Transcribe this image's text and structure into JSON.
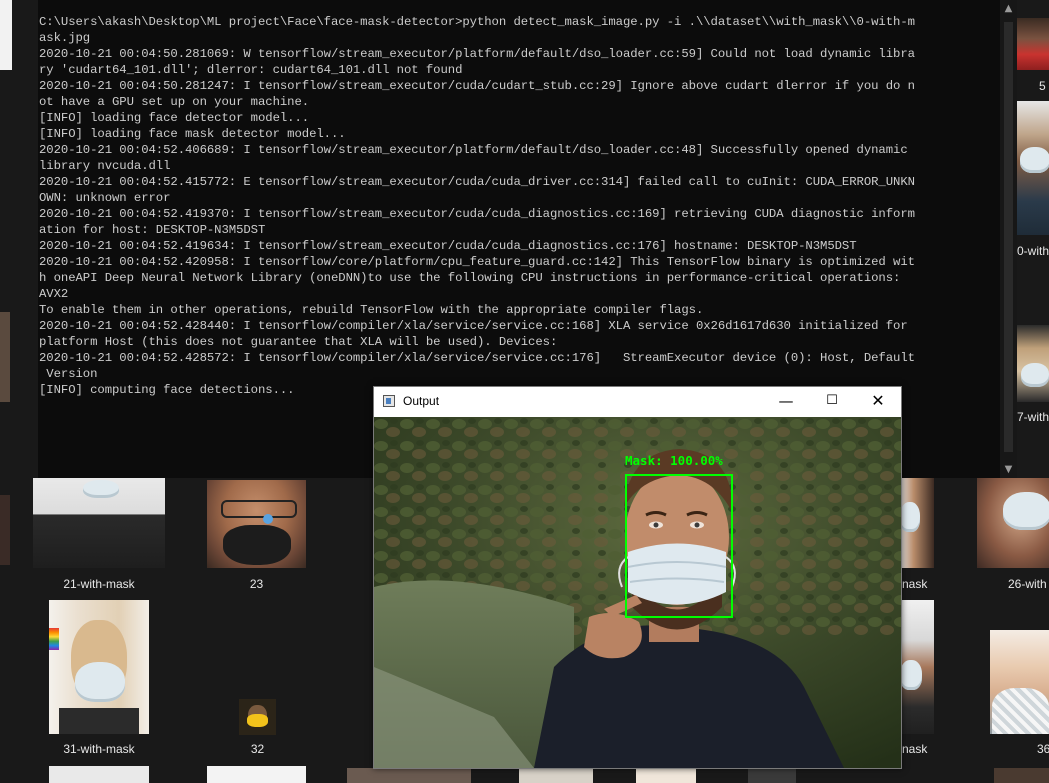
{
  "thumbnails": [
    {
      "label": ""
    },
    {
      "label": "21-with-mask"
    },
    {
      "label": "23"
    },
    {
      "label": "31-with-mask"
    },
    {
      "label": "32"
    },
    {
      "label": "5"
    },
    {
      "label": "0-with"
    },
    {
      "label": "7-with"
    },
    {
      "label": "nask"
    },
    {
      "label": "26-with"
    },
    {
      "label": "nask"
    },
    {
      "label": "36"
    }
  ],
  "console": {
    "lines": [
      "C:\\Users\\akash\\Desktop\\ML project\\Face\\face-mask-detector>python detect_mask_image.py -i .\\\\dataset\\\\with_mask\\\\0-with-m",
      "ask.jpg",
      "2020-10-21 00:04:50.281069: W tensorflow/stream_executor/platform/default/dso_loader.cc:59] Could not load dynamic libra",
      "ry 'cudart64_101.dll'; dlerror: cudart64_101.dll not found",
      "2020-10-21 00:04:50.281247: I tensorflow/stream_executor/cuda/cudart_stub.cc:29] Ignore above cudart dlerror if you do n",
      "ot have a GPU set up on your machine.",
      "[INFO] loading face detector model...",
      "[INFO] loading face mask detector model...",
      "2020-10-21 00:04:52.406689: I tensorflow/stream_executor/platform/default/dso_loader.cc:48] Successfully opened dynamic",
      "library nvcuda.dll",
      "2020-10-21 00:04:52.415772: E tensorflow/stream_executor/cuda/cuda_driver.cc:314] failed call to cuInit: CUDA_ERROR_UNKN",
      "OWN: unknown error",
      "2020-10-21 00:04:52.419370: I tensorflow/stream_executor/cuda/cuda_diagnostics.cc:169] retrieving CUDA diagnostic inform",
      "ation for host: DESKTOP-N3M5DST",
      "2020-10-21 00:04:52.419634: I tensorflow/stream_executor/cuda/cuda_diagnostics.cc:176] hostname: DESKTOP-N3M5DST",
      "2020-10-21 00:04:52.420958: I tensorflow/core/platform/cpu_feature_guard.cc:142] This TensorFlow binary is optimized wit",
      "h oneAPI Deep Neural Network Library (oneDNN)to use the following CPU instructions in performance-critical operations:",
      "AVX2",
      "To enable them in other operations, rebuild TensorFlow with the appropriate compiler flags.",
      "2020-10-21 00:04:52.428440: I tensorflow/compiler/xla/service/service.cc:168] XLA service 0x26d1617d630 initialized for",
      "platform Host (this does not guarantee that XLA will be used). Devices:",
      "2020-10-21 00:04:52.428572: I tensorflow/compiler/xla/service/service.cc:176]   StreamExecutor device (0): Host, Default",
      " Version",
      "[INFO] computing face detections..."
    ]
  },
  "output_window": {
    "title": "Output",
    "minimize_glyph": "—",
    "maximize_glyph": "☐",
    "close_glyph": "✕",
    "detection_label": "Mask: 100.00%",
    "box_color": "#00ff00"
  }
}
